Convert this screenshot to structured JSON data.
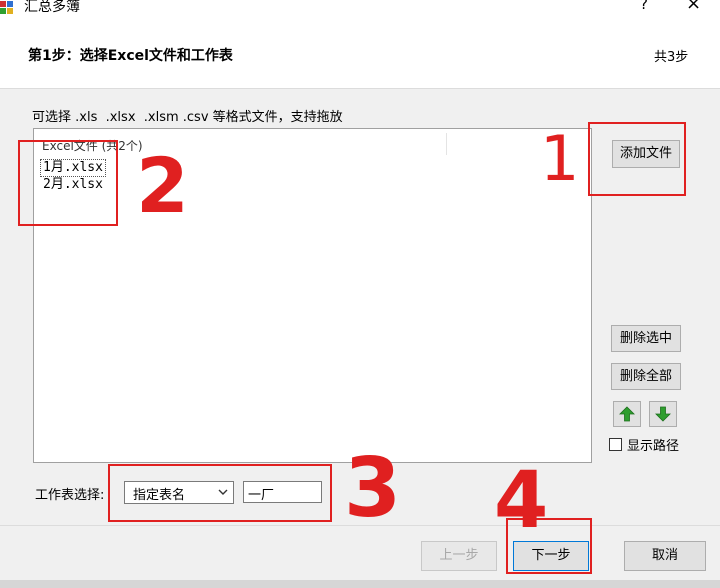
{
  "window": {
    "title": "汇总多簿",
    "help": "?",
    "close": "×"
  },
  "header": {
    "step_title": "第1步：选择Excel文件和工作表",
    "step_count": "共3步"
  },
  "hint": "可选择 .xls  .xlsx  .xlsm .csv 等格式文件，支持拖放",
  "file_list": {
    "header": "Excel文件 (共2个)",
    "items": [
      "1月.xlsx",
      "2月.xlsx"
    ]
  },
  "buttons": {
    "add_file": "添加文件",
    "delete_selected": "删除选中",
    "delete_all": "删除全部",
    "prev": "上一步",
    "next": "下一步",
    "cancel": "取消"
  },
  "show_path": {
    "label": "显示路径",
    "checked": false
  },
  "sheet_select": {
    "label": "工作表选择:",
    "mode": "指定表名",
    "value": "一厂"
  },
  "annotations": [
    "1",
    "2",
    "3",
    "4"
  ],
  "colors": {
    "annotation": "#e02020",
    "arrow_green": "#2e9e2e"
  }
}
